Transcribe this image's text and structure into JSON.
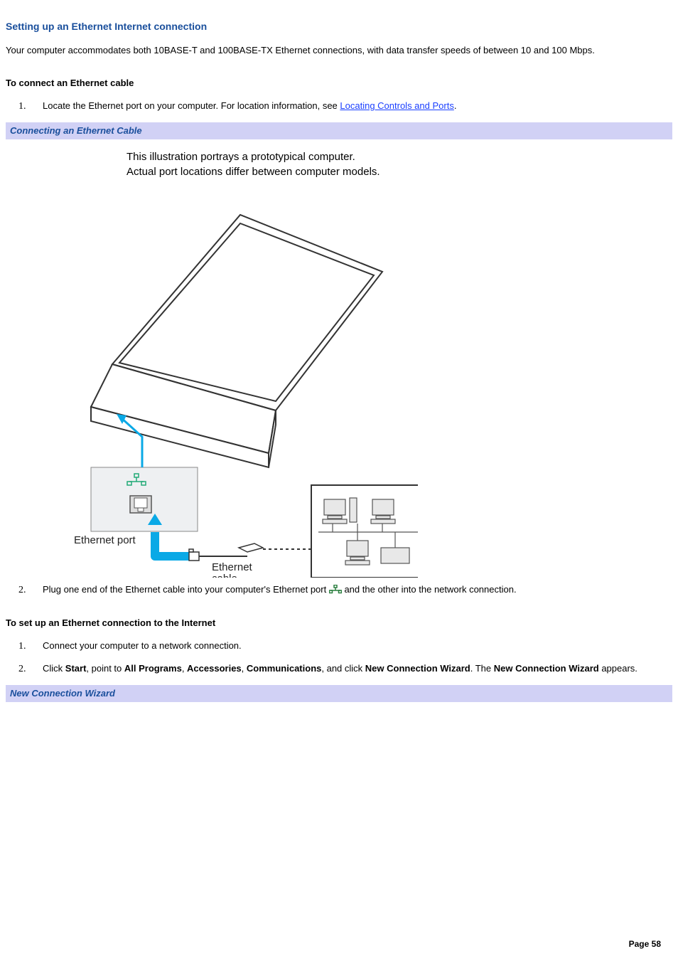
{
  "heading": "Setting up an Ethernet Internet connection",
  "intro": "Your computer accommodates both 10BASE-T and 100BASE-TX Ethernet connections, with data transfer speeds of between 10 and 100 Mbps.",
  "section1": {
    "title": "To connect an Ethernet cable",
    "step1_pre": "Locate the Ethernet port on your computer. For location information, see ",
    "step1_link": "Locating Controls and Ports",
    "step1_post": ".",
    "band": "Connecting an Ethernet Cable",
    "illus_caption1": "This illustration portrays a prototypical computer.",
    "illus_caption2": "Actual port locations differ between computer models.",
    "illus_labels": {
      "ethernet_port": "Ethernet port",
      "ethernet_cable": "Ethernet\ncable"
    },
    "step2_pre": "Plug one end of the Ethernet cable into your computer's Ethernet port ",
    "step2_post": " and the other into the network connection."
  },
  "section2": {
    "title": "To set up an Ethernet connection to the Internet",
    "step1": "Connect your computer to a network connection.",
    "step2_pre": "Click ",
    "step2_b1": "Start",
    "step2_m1": ", point to ",
    "step2_b2": "All Programs",
    "step2_m2": ", ",
    "step2_b3": "Accessories",
    "step2_m3": ", ",
    "step2_b4": "Communications",
    "step2_m4": ", and click ",
    "step2_b5": "New Connection Wizard",
    "step2_m5": ". The ",
    "step2_b6": "New Connection Wizard",
    "step2_m6": " appears.",
    "band": "New Connection Wizard"
  },
  "footer": "Page 58"
}
